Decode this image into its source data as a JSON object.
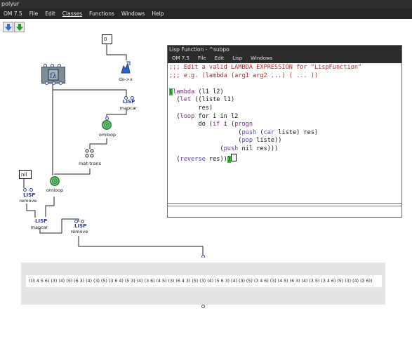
{
  "window": {
    "title": "polyur"
  },
  "menu": [
    "OM 7.5",
    "File",
    "Edit",
    "Classes",
    "Functions",
    "Windows",
    "Help"
  ],
  "toolbar": {
    "down_icon": "blue-down-arrow-icon",
    "up_icon": "green-up-arrow-icon"
  },
  "patch": {
    "number_box_value": "0",
    "nil_box_value": "nil",
    "labels": {
      "dxx": "dx->x",
      "mapcar1": "mapcar",
      "omloop1": "omloop",
      "mattrans": "mat-trans",
      "omloop2": "omloop",
      "remove1": "remove",
      "mapcar2": "mapcar",
      "remove2": "remove"
    },
    "lisp_tag": "LISP"
  },
  "lisp_window": {
    "title": "Lisp Function - ^subpo",
    "menu": [
      "OM 7.5",
      "File",
      "Edit",
      "Lisp",
      "Windows"
    ],
    "comment1": ";;; Edit a valid LAMBDA EXPRESSION for \"LispFunction\"",
    "comment2": ";;; e.g. (lambda (arg1 arg2 ...) ( ... ))"
  },
  "result": {
    "text": "((3 4 5 6) (3) (4) (5) (6 3) (4) (3) (5) (3 6 4) (5 3) (4) (3 6) (4 5) (3) (6 4 3) (5) (3) (4) (5 6 3) (4) (3) (5) (3 4 6) (3) (4 5) (6 3) (4) (3 5) (3 4 6) (5) (3) (4) (3 6))"
  }
}
